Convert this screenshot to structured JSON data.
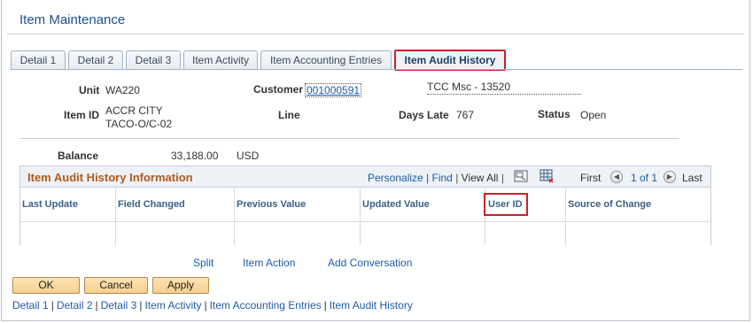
{
  "page": {
    "title": "Item Maintenance"
  },
  "tabs": [
    {
      "label": "Detail 1"
    },
    {
      "label": "Detail 2"
    },
    {
      "label": "Detail 3"
    },
    {
      "label": "Item Activity"
    },
    {
      "label": "Item Accounting Entries"
    },
    {
      "label": "Item Audit History",
      "active": true
    }
  ],
  "header": {
    "unit_label": "Unit",
    "unit_value": "WA220",
    "customer_label": "Customer",
    "customer_value": "001000591",
    "customer_name": "TCC Msc - 13520",
    "item_id_label": "Item ID",
    "item_id_line1": "ACCR CITY",
    "item_id_line2": "TACO-O/C-02",
    "line_label": "Line",
    "days_late_label": "Days Late",
    "days_late_value": "767",
    "status_label": "Status",
    "status_value": "Open",
    "balance_label": "Balance",
    "balance_value": "33,188.00",
    "currency": "USD"
  },
  "grid": {
    "title": "Item Audit History Information",
    "nav": {
      "personalize": "Personalize",
      "find": "Find",
      "view_all": "View All",
      "first": "First",
      "range": "1 of 1",
      "last": "Last",
      "sep": "|"
    },
    "columns": [
      "Last Update",
      "Field Changed",
      "Previous Value",
      "Updated Value",
      "User ID",
      "Source of Change"
    ],
    "icons": [
      "zoom-icon",
      "download-grid-icon",
      "prev-arrow-icon",
      "next-arrow-icon"
    ]
  },
  "actions": {
    "split": "Split",
    "item_action": "Item Action",
    "add_conversation": "Add Conversation"
  },
  "buttons": {
    "ok": "OK",
    "cancel": "Cancel",
    "apply": "Apply"
  },
  "footer_links": [
    "Detail 1",
    "Detail 2",
    "Detail 3",
    "Item Activity",
    "Item Accounting Entries",
    "Item Audit History"
  ],
  "footer_sep": "|",
  "colors": {
    "link": "#1e5aa8",
    "highlight": "#cc1f2b",
    "grid_title": "#b05a1c",
    "button": "#f5cf8e"
  }
}
